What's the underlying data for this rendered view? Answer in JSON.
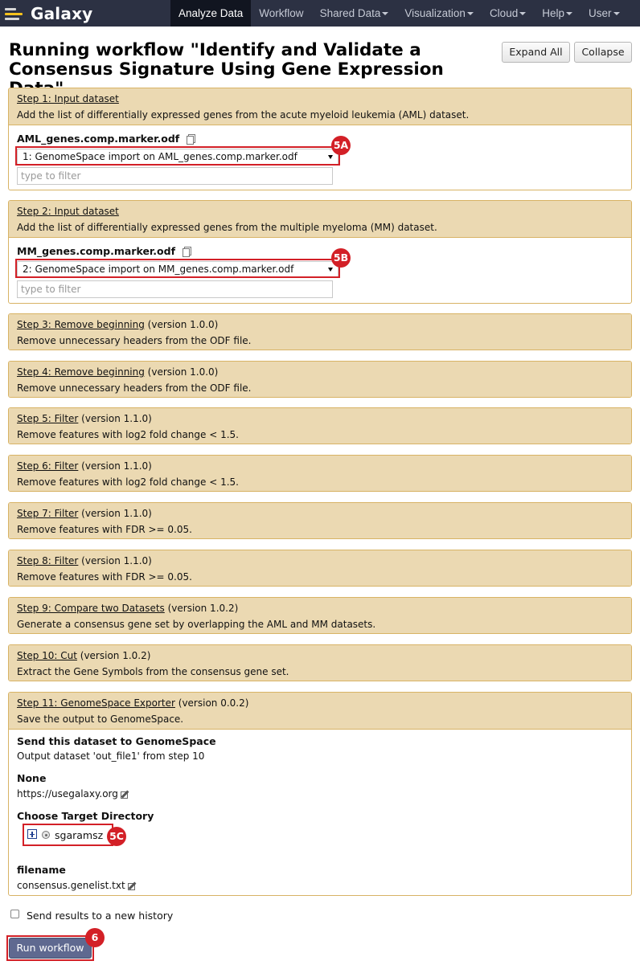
{
  "masthead": {
    "brand": "Galaxy",
    "nav": [
      {
        "label": "Analyze Data",
        "active": true,
        "dropdown": false
      },
      {
        "label": "Workflow",
        "active": false,
        "dropdown": false
      },
      {
        "label": "Shared Data",
        "active": false,
        "dropdown": true
      },
      {
        "label": "Visualization",
        "active": false,
        "dropdown": true
      },
      {
        "label": "Cloud",
        "active": false,
        "dropdown": true
      },
      {
        "label": "Help",
        "active": false,
        "dropdown": true
      },
      {
        "label": "User",
        "active": false,
        "dropdown": true
      }
    ]
  },
  "page": {
    "title": "Running workflow \"Identify and Validate a Consensus Signature Using Gene Expression Data\"",
    "expand_all": "Expand All",
    "collapse": "Collapse"
  },
  "steps": [
    {
      "link": "Step 1: Input dataset",
      "version": "",
      "desc": "Add the list of differentially expressed genes from the acute myeloid leukemia (AML) dataset.",
      "input": {
        "label": "AML_genes.comp.marker.odf",
        "selected": "1: GenomeSpace import on AML_genes.comp.marker.odf",
        "filter_placeholder": "type to filter",
        "badge": "5A"
      }
    },
    {
      "link": "Step 2: Input dataset",
      "version": "",
      "desc": "Add the list of differentially expressed genes from the multiple myeloma (MM) dataset.",
      "input": {
        "label": "MM_genes.comp.marker.odf",
        "selected": "2: GenomeSpace import on MM_genes.comp.marker.odf",
        "filter_placeholder": "type to filter",
        "badge": "5B"
      }
    },
    {
      "link": "Step 3: Remove beginning",
      "version": " (version 1.0.0)",
      "desc": "Remove unnecessary headers from the ODF file."
    },
    {
      "link": "Step 4: Remove beginning",
      "version": " (version 1.0.0)",
      "desc": "Remove unnecessary headers from the ODF file."
    },
    {
      "link": "Step 5: Filter",
      "version": " (version 1.1.0)",
      "desc": "Remove features with log2 fold change < 1.5."
    },
    {
      "link": "Step 6: Filter",
      "version": " (version 1.1.0)",
      "desc": "Remove features with log2 fold change < 1.5."
    },
    {
      "link": "Step 7: Filter",
      "version": " (version 1.1.0)",
      "desc": "Remove features with FDR >= 0.05."
    },
    {
      "link": "Step 8: Filter",
      "version": " (version 1.1.0)",
      "desc": "Remove features with FDR >= 0.05."
    },
    {
      "link": "Step 9: Compare two Datasets",
      "version": " (version 1.0.2)",
      "desc": "Generate a consensus gene set by overlapping the AML and MM datasets."
    },
    {
      "link": "Step 10: Cut",
      "version": " (version 1.0.2)",
      "desc": "Extract the Gene Symbols from the consensus gene set."
    },
    {
      "link": "Step 11: GenomeSpace Exporter",
      "version": " (version 0.0.2)",
      "desc": "Save the output to GenomeSpace."
    }
  ],
  "exporter": {
    "send_label": "Send this dataset to GenomeSpace",
    "send_value": "Output dataset 'out_file1' from step 10",
    "none_label": "None",
    "none_value": "https://usegalaxy.org",
    "dir_label": "Choose Target Directory",
    "dir_value": "sgaramsz",
    "dir_badge": "5C",
    "filename_label": "filename",
    "filename_value": "consensus.genelist.txt"
  },
  "footer": {
    "new_history_label": "Send results to a new history",
    "new_history_checked": false,
    "run_button": "Run workflow",
    "run_badge": "6"
  },
  "colors": {
    "masthead": "#2c3143",
    "step_header": "#ebd9b2",
    "step_border": "#d8b365",
    "highlight": "#d32027",
    "run_button": "#5f6990"
  },
  "icons": {
    "copy": "copy-icon",
    "edit": "edit-icon",
    "expand": "plus-box-icon",
    "radio": "radio-icon"
  }
}
